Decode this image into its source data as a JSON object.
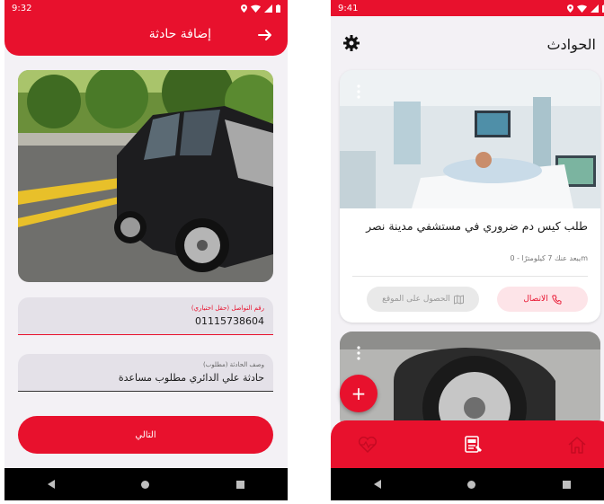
{
  "left_screen": {
    "status": {
      "time": "9:32"
    },
    "appbar": {
      "title": "إضافة حادثة"
    },
    "phone_field": {
      "label": "رقم التواصل (حقل اختياري)",
      "value": "01115738604"
    },
    "description_field": {
      "label": "وصف الحادثة (مطلوب)",
      "value": "حادثة علي الدائري مطلوب مساعدة"
    },
    "next_button": "التالي"
  },
  "right_screen": {
    "status": {
      "time": "9:41"
    },
    "header": {
      "title": "الحوادث"
    },
    "card": {
      "title": "طلب كيس دم ضروري في مستشفي مدينة نصر",
      "meta": "يبعد عنك 7 كيلومترًا - 0m",
      "call_button": "الاتصال",
      "location_button": "الحصول على الموقع"
    },
    "fab_label": "+"
  },
  "colors": {
    "accent": "#e8112d",
    "background": "#f3f1f5",
    "call_button_bg": "#fde4e8"
  },
  "icons": [
    "arrow-right-icon",
    "gear-icon",
    "phone-icon",
    "map-icon",
    "sos-icon",
    "home-icon",
    "heartbeat-icon",
    "more-vert-icon",
    "plus-icon"
  ]
}
